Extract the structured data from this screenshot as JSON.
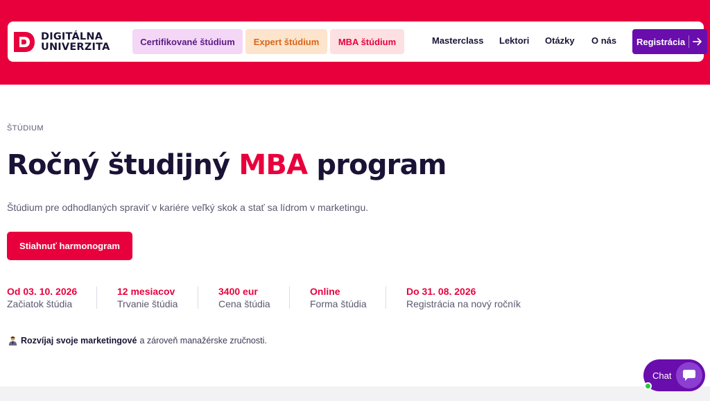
{
  "brand": {
    "line1": "DIGITÁLNA",
    "line2": "UNIVERZITA",
    "logo_icon": "du-monogram-icon",
    "accent_color": "#e8003d",
    "purple_color": "#6a0dad"
  },
  "nav": {
    "pills": [
      {
        "label": "Certifikované štúdium",
        "color": "#5a1b84",
        "bg": "#f4d6f7"
      },
      {
        "label": "Expert štúdium",
        "color": "#d9651a",
        "bg": "#fde4cc"
      },
      {
        "label": "MBA štúdium",
        "color": "#e8003d",
        "bg": "#fde0e2"
      }
    ],
    "links": [
      "Masterclass",
      "Lektori",
      "Otázky",
      "O nás"
    ],
    "register": {
      "label": "Registrácia",
      "icon": "arrow-right-icon"
    }
  },
  "hero": {
    "eyebrow": "ŠTÚDIUM",
    "title_before": "Ročný študijný ",
    "title_accent": "MBA",
    "title_after": " program",
    "subtitle": "Štúdium pre odhodlaných spraviť v kariére veľký skok a stať sa lídrom v marketingu.",
    "cta_label": "Stiahnuť harmonogram"
  },
  "stats": [
    {
      "value": "Od 03. 10. 2026",
      "label": "Začiatok štúdia"
    },
    {
      "value": "12 mesiacov",
      "label": "Trvanie štúdia"
    },
    {
      "value": "3400 eur",
      "label": "Cena štúdia"
    },
    {
      "value": "Online",
      "label": "Forma štúdia"
    },
    {
      "value": "Do 31. 08. 2026",
      "label": "Registrácia na nový ročník"
    }
  ],
  "motivation": {
    "icon": "person-icon",
    "bold": "Rozvíjaj svoje marketingové",
    "rest": "a zároveň manažérske zručnosti."
  },
  "chat": {
    "label": "Chat",
    "icon": "chat-bubble-icon",
    "status": "online"
  }
}
